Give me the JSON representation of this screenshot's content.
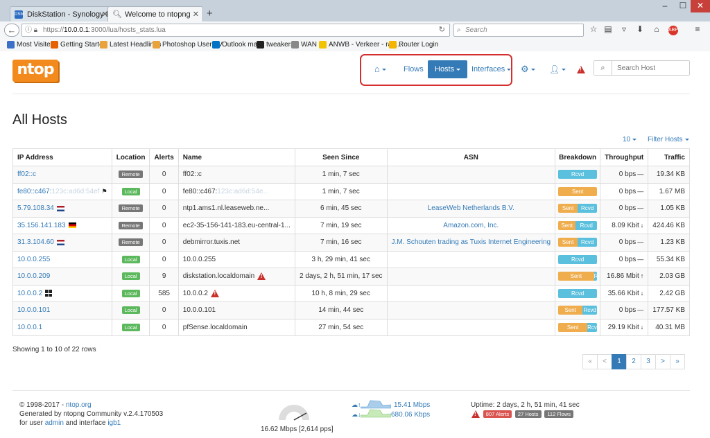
{
  "browser": {
    "tabs": [
      {
        "label": "DiskStation - Synology DiskS"
      },
      {
        "label": "Welcome to ntopng"
      }
    ],
    "url_prefix": "https://",
    "url_host": "10.0.0.1",
    "url_rest": ":3000/lua/hosts_stats.lua",
    "search_placeholder": "Search",
    "bookmarks": [
      {
        "label": "Most Visited",
        "color": "#3a70c8"
      },
      {
        "label": "Getting Started",
        "color": "#e66000"
      },
      {
        "label": "Latest Headlines",
        "color": "#e8a33d"
      },
      {
        "label": "Photoshop User TV",
        "color": "#e8a33d"
      },
      {
        "label": "Outlook mail",
        "color": "#0072c6"
      },
      {
        "label": "tweakers",
        "color": "#222222"
      },
      {
        "label": "WAN",
        "color": "#888888"
      },
      {
        "label": "ANWB - Verkeer - ran...",
        "color": "#f2c300"
      },
      {
        "label": "Router Login",
        "color": "#f4b400"
      }
    ]
  },
  "app": {
    "logo": "ntop",
    "nav": {
      "flows": "Flows",
      "hosts": "Hosts",
      "interfaces": "Interfaces"
    },
    "search_placeholder": "Search Host"
  },
  "page": {
    "title": "All Hosts",
    "per_page": "10",
    "filter_label": "Filter Hosts",
    "columns": [
      "IP Address",
      "Location",
      "Alerts",
      "Name",
      "Seen Since",
      "ASN",
      "Breakdown",
      "Throughput",
      "Traffic"
    ],
    "rows": [
      {
        "ip": "ff02::c",
        "ip_blur": "",
        "location": "Remote",
        "alerts": "0",
        "name": "ff02::c",
        "name_blur": "",
        "seen": "1 min, 7 sec",
        "asn": "",
        "sent_pct": 0,
        "rcvd_pct": 100,
        "throughput": "0 bps",
        "trend": "—",
        "traffic": "19.34 KB"
      },
      {
        "ip": "fe80::c467:",
        "ip_blur": "123c:ad6d:54ef",
        "location": "Local",
        "alerts": "0",
        "name": "fe80::c467:",
        "name_blur": "123c:ad6d:54e...",
        "seen": "1 min, 7 sec",
        "asn": "",
        "sent_pct": 100,
        "rcvd_pct": 0,
        "throughput": "0 bps",
        "trend": "—",
        "traffic": "1.67 MB"
      },
      {
        "ip": "5.79.108.34",
        "ip_blur": "",
        "location": "Remote",
        "alerts": "0",
        "name": "ntp1.ams1.nl.leaseweb.ne...",
        "name_blur": "",
        "seen": "6 min, 45 sec",
        "asn": "LeaseWeb Netherlands B.V.",
        "sent_pct": 50,
        "rcvd_pct": 50,
        "throughput": "0 bps",
        "trend": "—",
        "traffic": "1.05 KB"
      },
      {
        "ip": "35.156.141.183",
        "ip_blur": "",
        "location": "Remote",
        "alerts": "0",
        "name": "ec2-35-156-141-183.eu-central-1...",
        "name_blur": "",
        "seen": "7 min, 19 sec",
        "asn": "Amazon.com, Inc.",
        "sent_pct": 45,
        "rcvd_pct": 55,
        "throughput": "8.09 Kbit",
        "trend": "↓",
        "traffic": "424.46 KB"
      },
      {
        "ip": "31.3.104.60",
        "ip_blur": "",
        "location": "Remote",
        "alerts": "0",
        "name": "debmirror.tuxis.net",
        "name_blur": "",
        "seen": "7 min, 16 sec",
        "asn": "J.M. Schouten trading as Tuxis Internet Engineering",
        "sent_pct": 50,
        "rcvd_pct": 50,
        "throughput": "0 bps",
        "trend": "—",
        "traffic": "1.23 KB"
      },
      {
        "ip": "10.0.0.255",
        "ip_blur": "",
        "location": "Local",
        "alerts": "0",
        "name": "10.0.0.255",
        "name_blur": "",
        "seen": "3 h, 29 min, 41 sec",
        "asn": "",
        "sent_pct": 0,
        "rcvd_pct": 100,
        "throughput": "0 bps",
        "trend": "—",
        "traffic": "55.34 KB"
      },
      {
        "ip": "10.0.0.209",
        "ip_blur": "",
        "location": "Local",
        "alerts": "9",
        "name": "diskstation.localdomain",
        "name_blur": "",
        "seen": "2 days, 2 h, 51 min, 17 sec",
        "asn": "",
        "sent_pct": 92,
        "rcvd_pct": 8,
        "throughput": "16.86 Mbit",
        "trend": "↑",
        "traffic": "2.03 GB"
      },
      {
        "ip": "10.0.0.2",
        "ip_blur": "",
        "location": "Local",
        "alerts": "585",
        "name": "10.0.0.2",
        "name_blur": "",
        "seen": "10 h, 8 min, 29 sec",
        "asn": "",
        "sent_pct": 0,
        "rcvd_pct": 100,
        "throughput": "35.66 Kbit",
        "trend": "↓",
        "traffic": "2.42 GB"
      },
      {
        "ip": "10.0.0.101",
        "ip_blur": "",
        "location": "Local",
        "alerts": "0",
        "name": "10.0.0.101",
        "name_blur": "",
        "seen": "14 min, 44 sec",
        "asn": "",
        "sent_pct": 63,
        "rcvd_pct": 37,
        "throughput": "0 bps",
        "trend": "—",
        "traffic": "177.57 KB"
      },
      {
        "ip": "10.0.0.1",
        "ip_blur": "",
        "location": "Local",
        "alerts": "0",
        "name": "pfSense.localdomain",
        "name_blur": "",
        "seen": "27 min, 54 sec",
        "asn": "",
        "sent_pct": 75,
        "rcvd_pct": 25,
        "throughput": "29.19 Kbit",
        "trend": "↓",
        "traffic": "40.31 MB"
      }
    ],
    "showing": "Showing 1 to 10 of 22 rows",
    "pagination": [
      "«",
      "<",
      "1",
      "2",
      "3",
      ">",
      "»"
    ],
    "current_page": "1"
  },
  "footer": {
    "copyright_prefix": "© 1998-2017 - ",
    "copyright_link": "ntop.org",
    "generated": "Generated by ntopng Community v.2.4.170503",
    "user_prefix": "for user ",
    "user": "admin",
    "iface_prefix": " and interface ",
    "iface": "igb1",
    "gauge_text": "16.62 Mbps [2,614 pps]",
    "upload": "15.41 Mbps",
    "download": "680.06 Kbps",
    "uptime": "Uptime: 2 days, 2 h, 51 min, 41 sec",
    "alerts_badge": "807 Alerts",
    "hosts_badge": "27 Hosts",
    "flows_badge": "112 Flows"
  },
  "labels": {
    "sent": "Sent",
    "rcvd": "Rcvd"
  },
  "colors": {
    "accent": "#337ab7",
    "brand": "#f28a1d",
    "sent": "#f0ad4e",
    "rcvd": "#5bc0de",
    "local": "#5cb85c",
    "remote": "#777777",
    "alert": "#c9302c"
  }
}
